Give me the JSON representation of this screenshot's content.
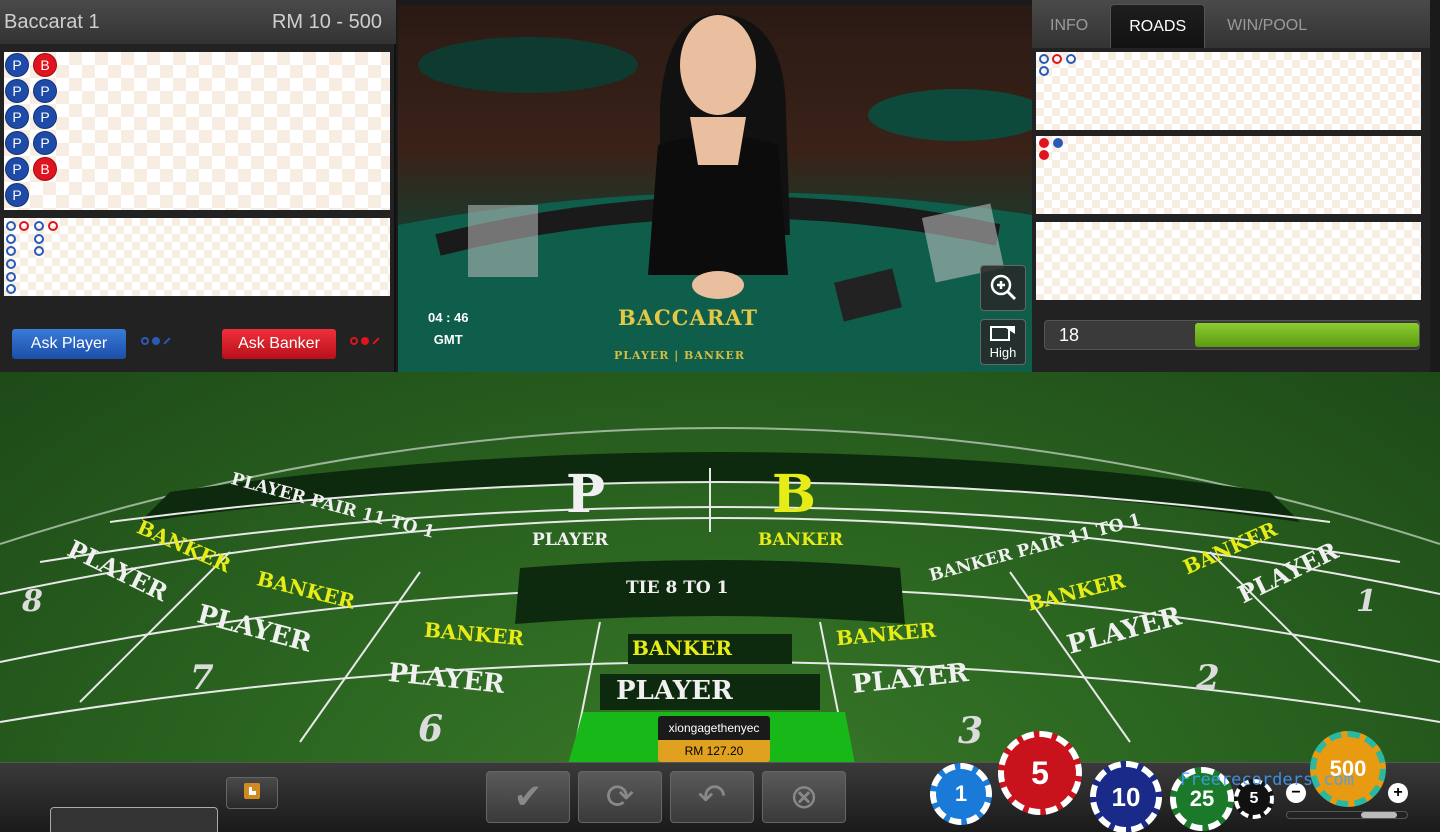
{
  "header": {
    "table_name": "Baccarat 1",
    "limits": "RM 10 - 500"
  },
  "bead_road": [
    [
      "P",
      "B"
    ],
    [
      "P",
      "P"
    ],
    [
      "P",
      "P"
    ],
    [
      "P",
      "P"
    ],
    [
      "P",
      "B"
    ],
    [
      "P"
    ]
  ],
  "ask": {
    "player": "Ask Player",
    "banker": "Ask Banker"
  },
  "video": {
    "clock_time": "04 : 46",
    "clock_zone": "GMT",
    "sign": "BACCARAT",
    "sign_sub": "PLAYER | BANKER",
    "quality_label": "High"
  },
  "tabs": [
    "INFO",
    "ROADS",
    "WIN/POOL"
  ],
  "active_tab": "ROADS",
  "timer": {
    "value": "18",
    "fraction": 0.6
  },
  "table": {
    "p_letter": "P",
    "p_label": "PLAYER",
    "b_letter": "B",
    "b_label": "BANKER",
    "player_pair": "PLAYER PAIR 11 TO 1",
    "banker_pair": "BANKER PAIR 11 TO 1",
    "tie": "TIE 8 TO 1",
    "banker": "BANKER",
    "player": "PLAYER",
    "seat_numbers": [
      "8",
      "7",
      "6",
      "3",
      "2",
      "1"
    ]
  },
  "player_tag": {
    "name": "xiongagethenyec",
    "balance": "RM 127.20"
  },
  "chips": [
    {
      "value": "1"
    },
    {
      "value": "5"
    },
    {
      "value": "10"
    },
    {
      "value": "25"
    },
    {
      "value": "5"
    },
    {
      "value": "500"
    }
  ],
  "controls": {
    "minus": "−",
    "plus": "+"
  },
  "watermark": "Freerecorders.com",
  "colors": {
    "player_blue": "#1e4aa8",
    "banker_red": "#e0141f",
    "felt_green": "#2a6420",
    "gold": "#e2c846"
  }
}
